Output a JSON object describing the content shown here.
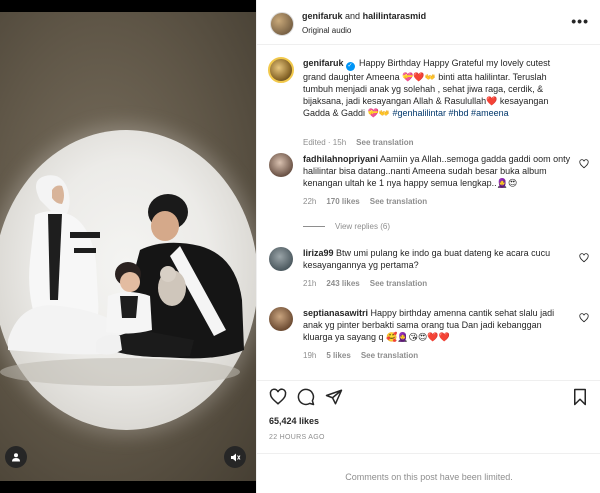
{
  "header": {
    "user1": "genifaruk",
    "and_text": "and",
    "user2": "halilintarasmid",
    "audio": "Original audio",
    "more": "•••"
  },
  "caption": {
    "username": "genifaruk",
    "text_before_emoji1": "Happy Birthday Happy Grateful my lovely cutest grand daughter Ameena",
    "emoji1": "💝❤️👐",
    "text_after_emoji1": "binti atta halilintar. Teruslah tumbuh menjadi anak yg solehah , sehat jiwa raga, cerdik, & bijaksana, jadi kesayangan Allah & Rasulullah",
    "emoji2": "❤️",
    "text_after_emoji2": "kesayangan Gadda & Gaddi",
    "emoji3": "💝👐",
    "hashtags": "#genhalilintar #hbd #ameena",
    "edited": "Edited",
    "time": "15h",
    "see_translation": "See translation"
  },
  "comments": [
    {
      "username": "fadhilahnopriyani",
      "text": "Aamiin ya Allah..semoga gadda gaddi oom onty halilintar bisa datang..nanti Ameena sudah besar buka album kenangan ultah ke 1 nya happy semua lengkap..",
      "emoji": "🧕😍",
      "time": "22h",
      "likes": "170 likes",
      "see_translation": "See translation",
      "view_replies": "View replies (6)"
    },
    {
      "username": "liriza99",
      "text": "Btw umi pulang ke indo ga buat dateng ke acara cucu kesayangannya yg pertama?",
      "emoji": "",
      "time": "21h",
      "likes": "243 likes",
      "see_translation": "See translation"
    },
    {
      "username": "septianasawitri",
      "text": "Happy birthday amenna cantik sehat slalu jadi anak yg pinter berbakti sama orang tua Dan jadi kebanggan kluarga ya sayang q",
      "emoji": "🥰🧕😘😍❤️❤️",
      "time": "19h",
      "likes": "5 likes",
      "see_translation": "See translation"
    }
  ],
  "actions": {
    "like_icon": "heart-icon",
    "comment_icon": "comment-icon",
    "share_icon": "paper-plane-icon",
    "save_icon": "bookmark-icon"
  },
  "likes": "65,424 likes",
  "date": "22 HOURS AGO",
  "limited_notice": "Comments on this post have been limited."
}
